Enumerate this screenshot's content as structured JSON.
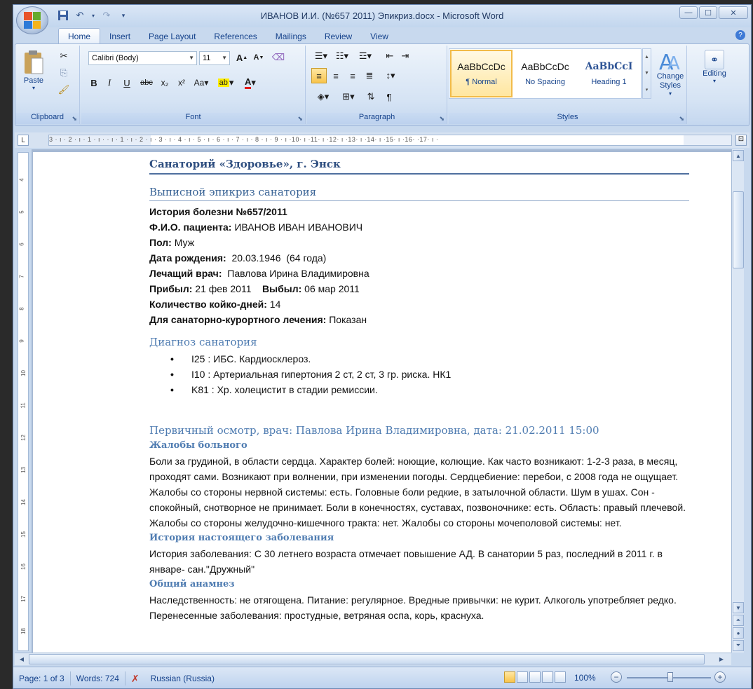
{
  "window": {
    "title": "ИВАНОВ И.И. (№657 2011) Эпикриз.docx - Microsoft Word",
    "controls": {
      "minimize": "—",
      "maximize": "☐",
      "close": "✕"
    }
  },
  "tabs": [
    {
      "label": "Home",
      "active": true
    },
    {
      "label": "Insert"
    },
    {
      "label": "Page Layout"
    },
    {
      "label": "References"
    },
    {
      "label": "Mailings"
    },
    {
      "label": "Review"
    },
    {
      "label": "View"
    }
  ],
  "ribbon": {
    "clipboard": {
      "label": "Clipboard",
      "paste": "Paste"
    },
    "font": {
      "label": "Font",
      "family": "Calibri (Body)",
      "size": "11"
    },
    "paragraph": {
      "label": "Paragraph"
    },
    "styles": {
      "label": "Styles",
      "items": [
        {
          "sample": "AaBbCcDc",
          "name": "¶ Normal"
        },
        {
          "sample": "AaBbCcDc",
          "name": "No Spacing"
        },
        {
          "sample": "AaBbCcI",
          "name": "Heading 1"
        }
      ],
      "change_styles": "Change Styles",
      "change_styles_arrow": "▾"
    },
    "editing": {
      "label": "Editing"
    }
  },
  "ruler": {
    "h_numbers": "3 · ı · 2 · ı · 1 · ı ·   · ı · 1 · ı · 2 · ı · 3 · ı · 4 · ı · 5 · ı · 6 · ı · 7 · ı · 8 · ı · 9 · ı ·10· ı ·11· ı ·12· ı ·13· ı ·14· ı ·15· ı ·16·   ·17· ı ·",
    "v_numbers": [
      "4",
      "5",
      "6",
      "7",
      "8",
      "9",
      "10",
      "11",
      "12",
      "13",
      "14",
      "15",
      "16",
      "17",
      "18"
    ]
  },
  "document": {
    "org": "Санаторий «Здоровье», г. Энск",
    "title": "Выписной эпикриз санатория",
    "fields": [
      {
        "label": "История болезни №657/2011",
        "value": ""
      },
      {
        "label": "Ф.И.О. пациента:",
        "value": " ИВАНОВ ИВАН ИВАНОВИЧ"
      },
      {
        "label": "Пол:",
        "value": " Муж"
      },
      {
        "label": "Дата рождения:",
        "value": "  20.03.1946  (64 года)"
      },
      {
        "label": "Лечащий врач:",
        "value": "  Павлова Ирина Владимировна"
      },
      {
        "label": "Прибыл:",
        "value": " 21 фев 2011    ",
        "label2": "Выбыл:",
        "value2": " 06 мар 2011"
      },
      {
        "label": "Количество койко-дней:",
        "value": " 14"
      },
      {
        "label": "Для санаторно-курортного лечения:",
        "value": " Показан"
      }
    ],
    "diagnosis_heading": "Диагноз санатория",
    "diagnoses": [
      "I25 : ИБС. Кардиосклероз.",
      "I10 : Артериальная гипертония 2 ст, 2 ст, 3 гр. риска. НК1",
      "K81 : Хр. холецистит в стадии ремиссии."
    ],
    "exam_heading": "Первичный осмотр, врач: Павлова Ирина Владимировна, дата: 21.02.2011 15:00",
    "complaints_heading": "Жалобы больного",
    "complaints_text": "Боли за грудиной, в области сердца. Характер болей: ноющие, колющие. Как часто возникают: 1-2-3 раза, в месяц,  проходят сами. Возникают при волнении, при изменении погоды. Сердцебиение: перебои, с 2008 года не ощущает. Жалобы со стороны нервной системы: есть. Головные боли редкие, в затылочной области. Шум в ушах. Сон - спокойный, снотворное не принимает. Боли в конечностях, суставах, позвоночнике: есть. Область: правый плечевой. Жалобы со стороны желудочно-кишечного тракта: нет. Жалобы со стороны мочеполовой системы: нет.",
    "history_heading": "История настоящего заболевания",
    "history_text": "История заболевания: С 30 летнего возраста отмечает повышение АД.  В санатории 5 раз, последний в 2011  г. в январе- сан.\"Дружный\"",
    "anamnesis_heading": "Общий анамнез",
    "anamnesis_text": "Наследственность: не отягощена. Питание: регулярное. Вредные привычки: не курит. Алкоголь употребляет редко. Перенесенные заболевания: простудные, ветряная оспа, корь, краснуха."
  },
  "status_bar": {
    "page": "Page: 1 of 3",
    "words": "Words: 724",
    "language": "Russian (Russia)",
    "zoom": "100%"
  },
  "colors": {
    "ribbon_text": "#15428b",
    "heading_blue": "#4f7cb1",
    "org_blue": "#2f4f80",
    "selected_style": "#f2bb49"
  }
}
